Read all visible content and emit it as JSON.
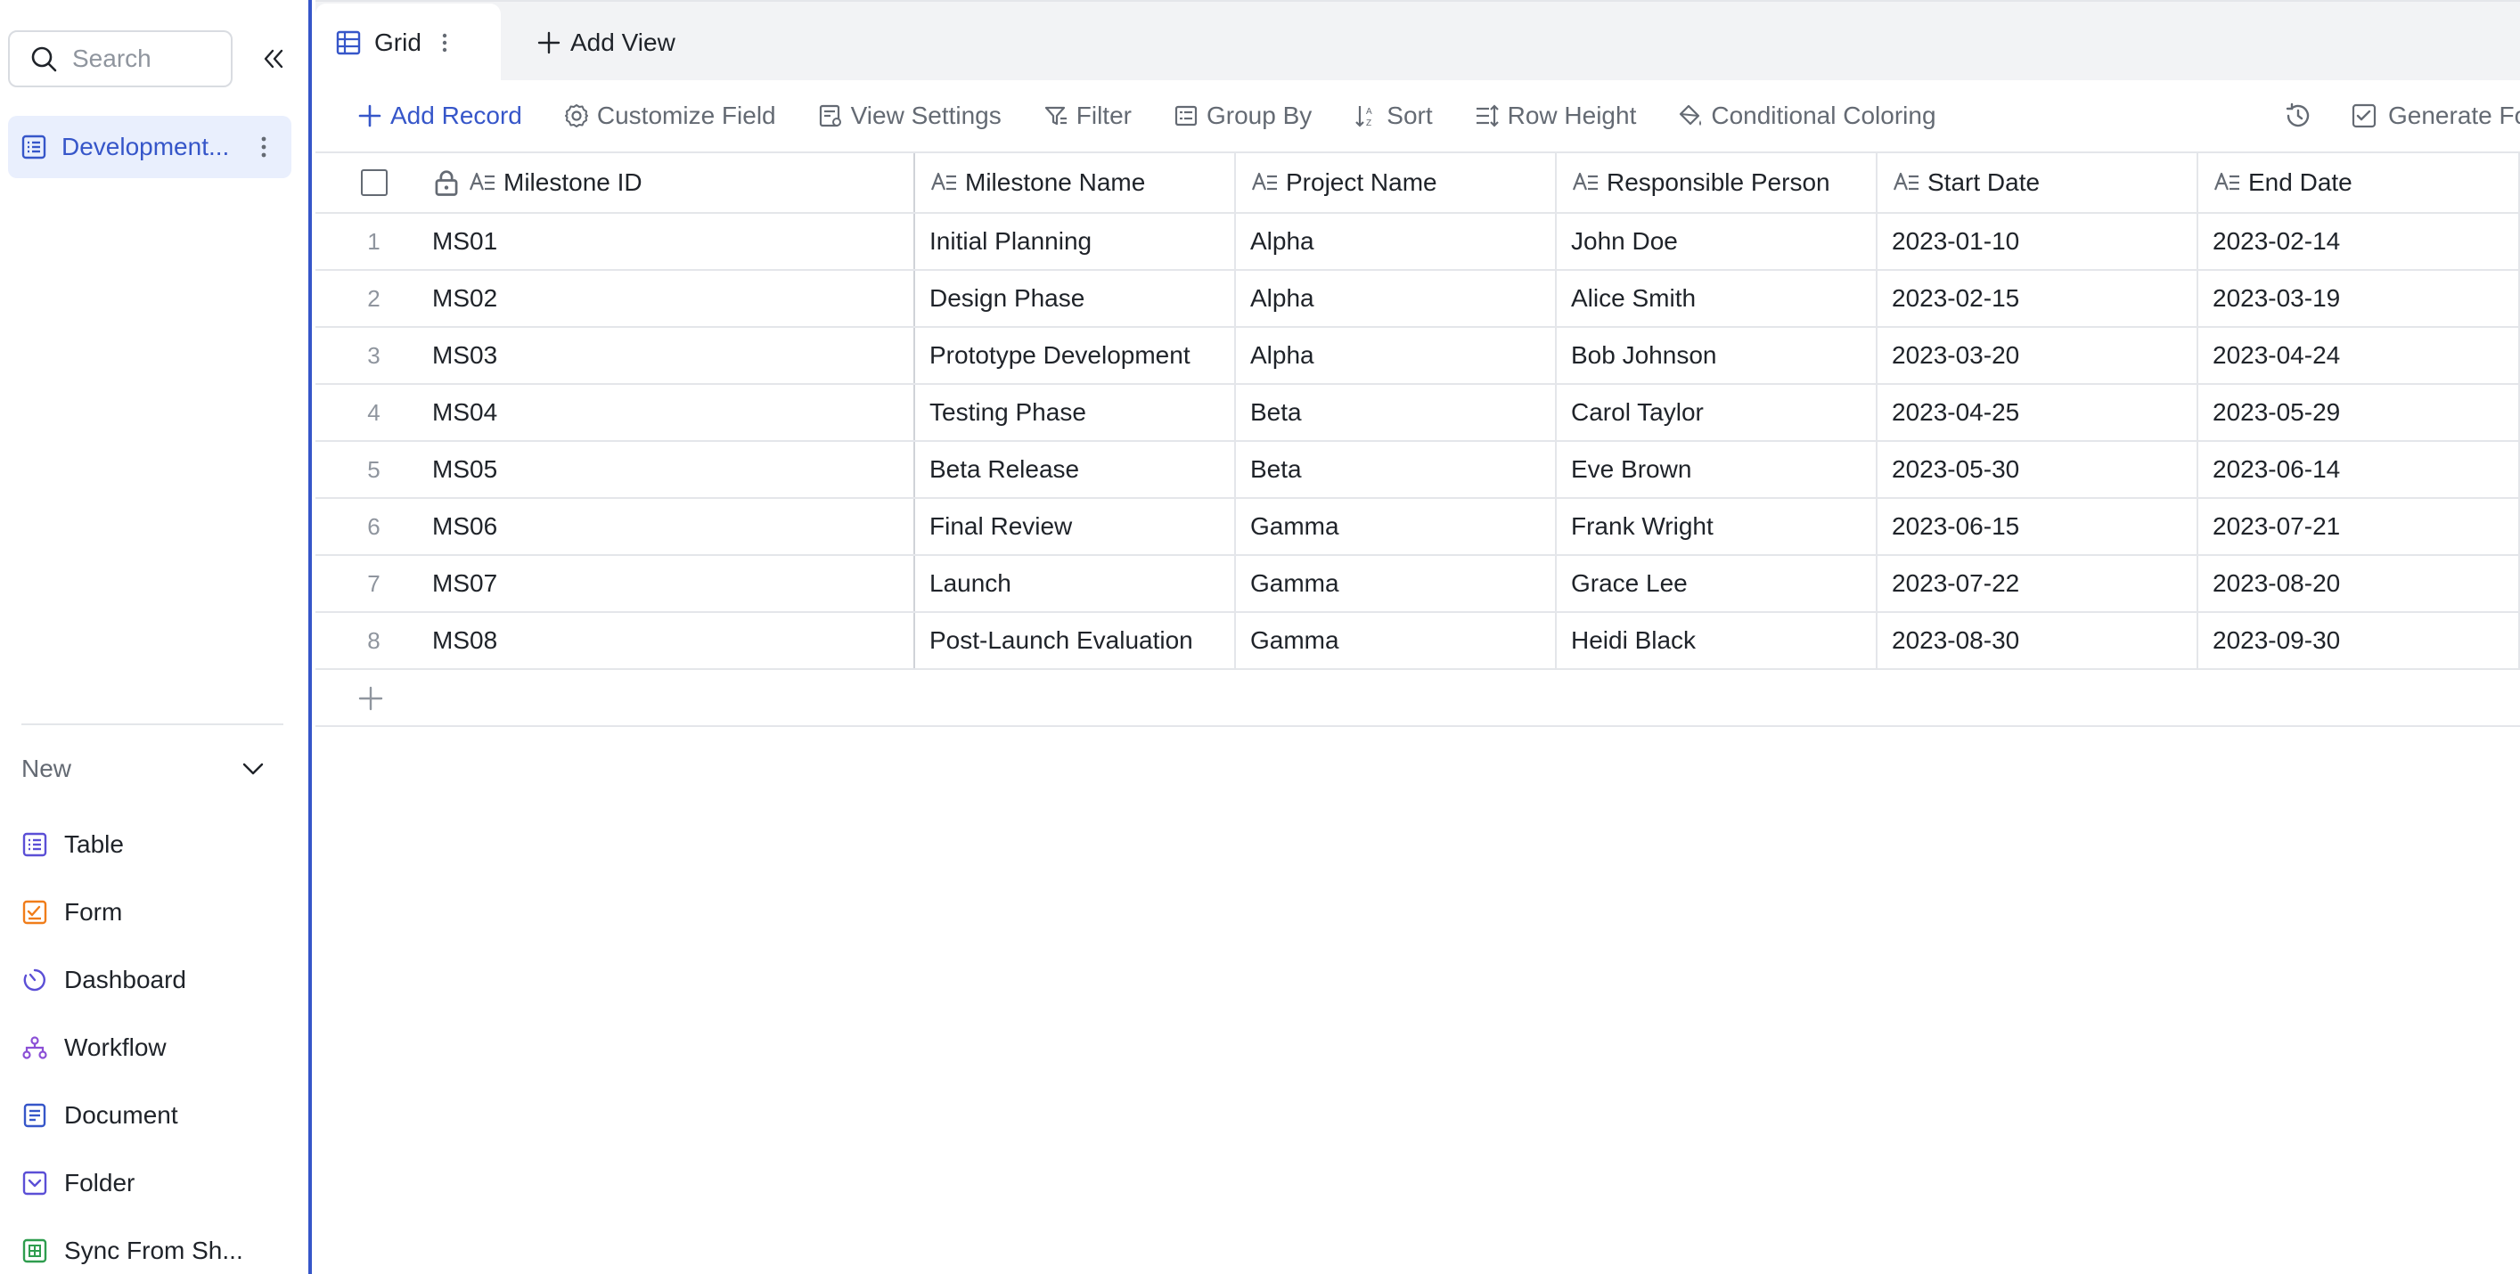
{
  "sidebar": {
    "search_placeholder": "Search",
    "active_item_label": "Development...",
    "new_label": "New",
    "new_items": [
      {
        "label": "Table",
        "icon": "table-icon",
        "color": "#5b4fd6"
      },
      {
        "label": "Form",
        "icon": "form-icon",
        "color": "#f07d1a"
      },
      {
        "label": "Dashboard",
        "icon": "dashboard-icon",
        "color": "#5b4fd6"
      },
      {
        "label": "Workflow",
        "icon": "workflow-icon",
        "color": "#8b4fd6"
      },
      {
        "label": "Document",
        "icon": "document-icon",
        "color": "#3656c9"
      },
      {
        "label": "Folder",
        "icon": "folder-icon",
        "color": "#5b4fd6"
      },
      {
        "label": "Sync From Sh...",
        "icon": "sheet-icon",
        "color": "#2e9d4e"
      }
    ]
  },
  "tabs": {
    "active_label": "Grid",
    "add_view_label": "Add View"
  },
  "toolbar": {
    "add_record": "Add Record",
    "customize_field": "Customize Field",
    "view_settings": "View Settings",
    "filter": "Filter",
    "group_by": "Group By",
    "sort": "Sort",
    "row_height": "Row Height",
    "conditional_coloring": "Conditional Coloring",
    "generate": "Generate Fo"
  },
  "grid": {
    "columns": [
      "Milestone ID",
      "Milestone Name",
      "Project Name",
      "Responsible Person",
      "Start Date",
      "End Date"
    ],
    "rows": [
      {
        "index": "1",
        "id": "MS01",
        "name": "Initial Planning",
        "project": "Alpha",
        "person": "John Doe",
        "start": "2023-01-10",
        "end": "2023-02-14"
      },
      {
        "index": "2",
        "id": "MS02",
        "name": "Design Phase",
        "project": "Alpha",
        "person": "Alice Smith",
        "start": "2023-02-15",
        "end": "2023-03-19"
      },
      {
        "index": "3",
        "id": "MS03",
        "name": "Prototype Development",
        "project": "Alpha",
        "person": "Bob Johnson",
        "start": "2023-03-20",
        "end": "2023-04-24"
      },
      {
        "index": "4",
        "id": "MS04",
        "name": "Testing Phase",
        "project": "Beta",
        "person": "Carol Taylor",
        "start": "2023-04-25",
        "end": "2023-05-29"
      },
      {
        "index": "5",
        "id": "MS05",
        "name": "Beta Release",
        "project": "Beta",
        "person": "Eve Brown",
        "start": "2023-05-30",
        "end": "2023-06-14"
      },
      {
        "index": "6",
        "id": "MS06",
        "name": "Final Review",
        "project": "Gamma",
        "person": "Frank Wright",
        "start": "2023-06-15",
        "end": "2023-07-21"
      },
      {
        "index": "7",
        "id": "MS07",
        "name": "Launch",
        "project": "Gamma",
        "person": "Grace Lee",
        "start": "2023-07-22",
        "end": "2023-08-20"
      },
      {
        "index": "8",
        "id": "MS08",
        "name": "Post-Launch Evaluation",
        "project": "Gamma",
        "person": "Heidi Black",
        "start": "2023-08-30",
        "end": "2023-09-30"
      }
    ]
  },
  "colors": {
    "accent": "#3656c9",
    "active_bg": "#e9effd",
    "border": "#e4e6ea",
    "muted_text": "#646a73"
  }
}
